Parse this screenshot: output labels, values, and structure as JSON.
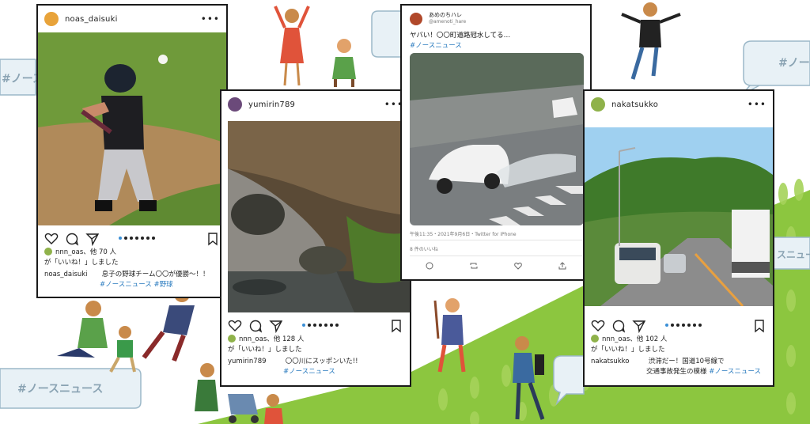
{
  "background": {
    "hill_color": "#8cc63f",
    "bubble_color": "#e8f1f6",
    "bubble_text": "#ノースニュース"
  },
  "posts": [
    {
      "username": "noas_daisuki",
      "likes": "nnn_oas、他 70 人",
      "liked_text": "が「いいね！」しました",
      "caption_user": "noas_daisuki",
      "caption": "息子の野球チーム〇〇が優勝〜！！",
      "tags": "#ノースニュース #野球",
      "avatar_color": "#e8a33a"
    },
    {
      "username": "yumirin789",
      "likes": "nnn_oas、他 128 人",
      "liked_text": "が「いいね！」しました",
      "caption_user": "yumirin789",
      "caption": "〇〇川にスッポンいた!!",
      "tags": "#ノースニュース",
      "avatar_color": "#6b4a7a"
    },
    {
      "username": "nakatsukko",
      "likes": "nnn_oas、他 102 人",
      "liked_text": "が「いいね！」しました",
      "caption_user": "nakatsukko",
      "caption": "渋滞だー！国道10号線で",
      "caption2": "交通事故発生の模様",
      "tags": "#ノースニュース",
      "avatar_color": "#8fb24a"
    }
  ],
  "tweet": {
    "name": "あめのちハレ",
    "handle": "@amenoti_hare",
    "text": "ヤバい！〇〇町道路冠水してる…",
    "tag": "#ノースニュース",
    "meta": "午後11:35・2021年9月6日・Twitter for iPhone",
    "likes": "8 件のいいね"
  },
  "icons": [
    "heart-icon",
    "comment-icon",
    "share-icon",
    "bookmark-icon",
    "more-icon"
  ]
}
